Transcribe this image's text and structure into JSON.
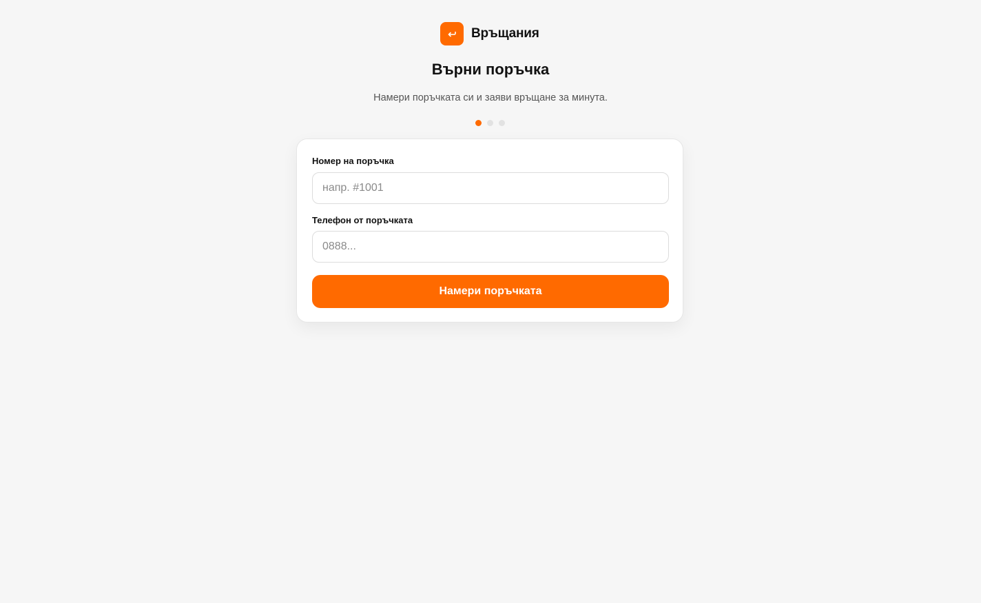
{
  "brand": {
    "name": "Връщания",
    "logo_icon": "return-arrow-icon",
    "accent_color": "#ff6a00"
  },
  "header": {
    "title": "Върни поръчка",
    "subtitle": "Намери поръчката си и заяви връщане за минута."
  },
  "steps": {
    "total": 3,
    "current": 1
  },
  "form": {
    "order_number": {
      "label": "Номер на поръчка",
      "value": "",
      "placeholder": "напр. #1001"
    },
    "phone": {
      "label": "Телефон от поръчката",
      "value": "",
      "placeholder": "0888..."
    },
    "submit_label": "Намери поръчката"
  }
}
